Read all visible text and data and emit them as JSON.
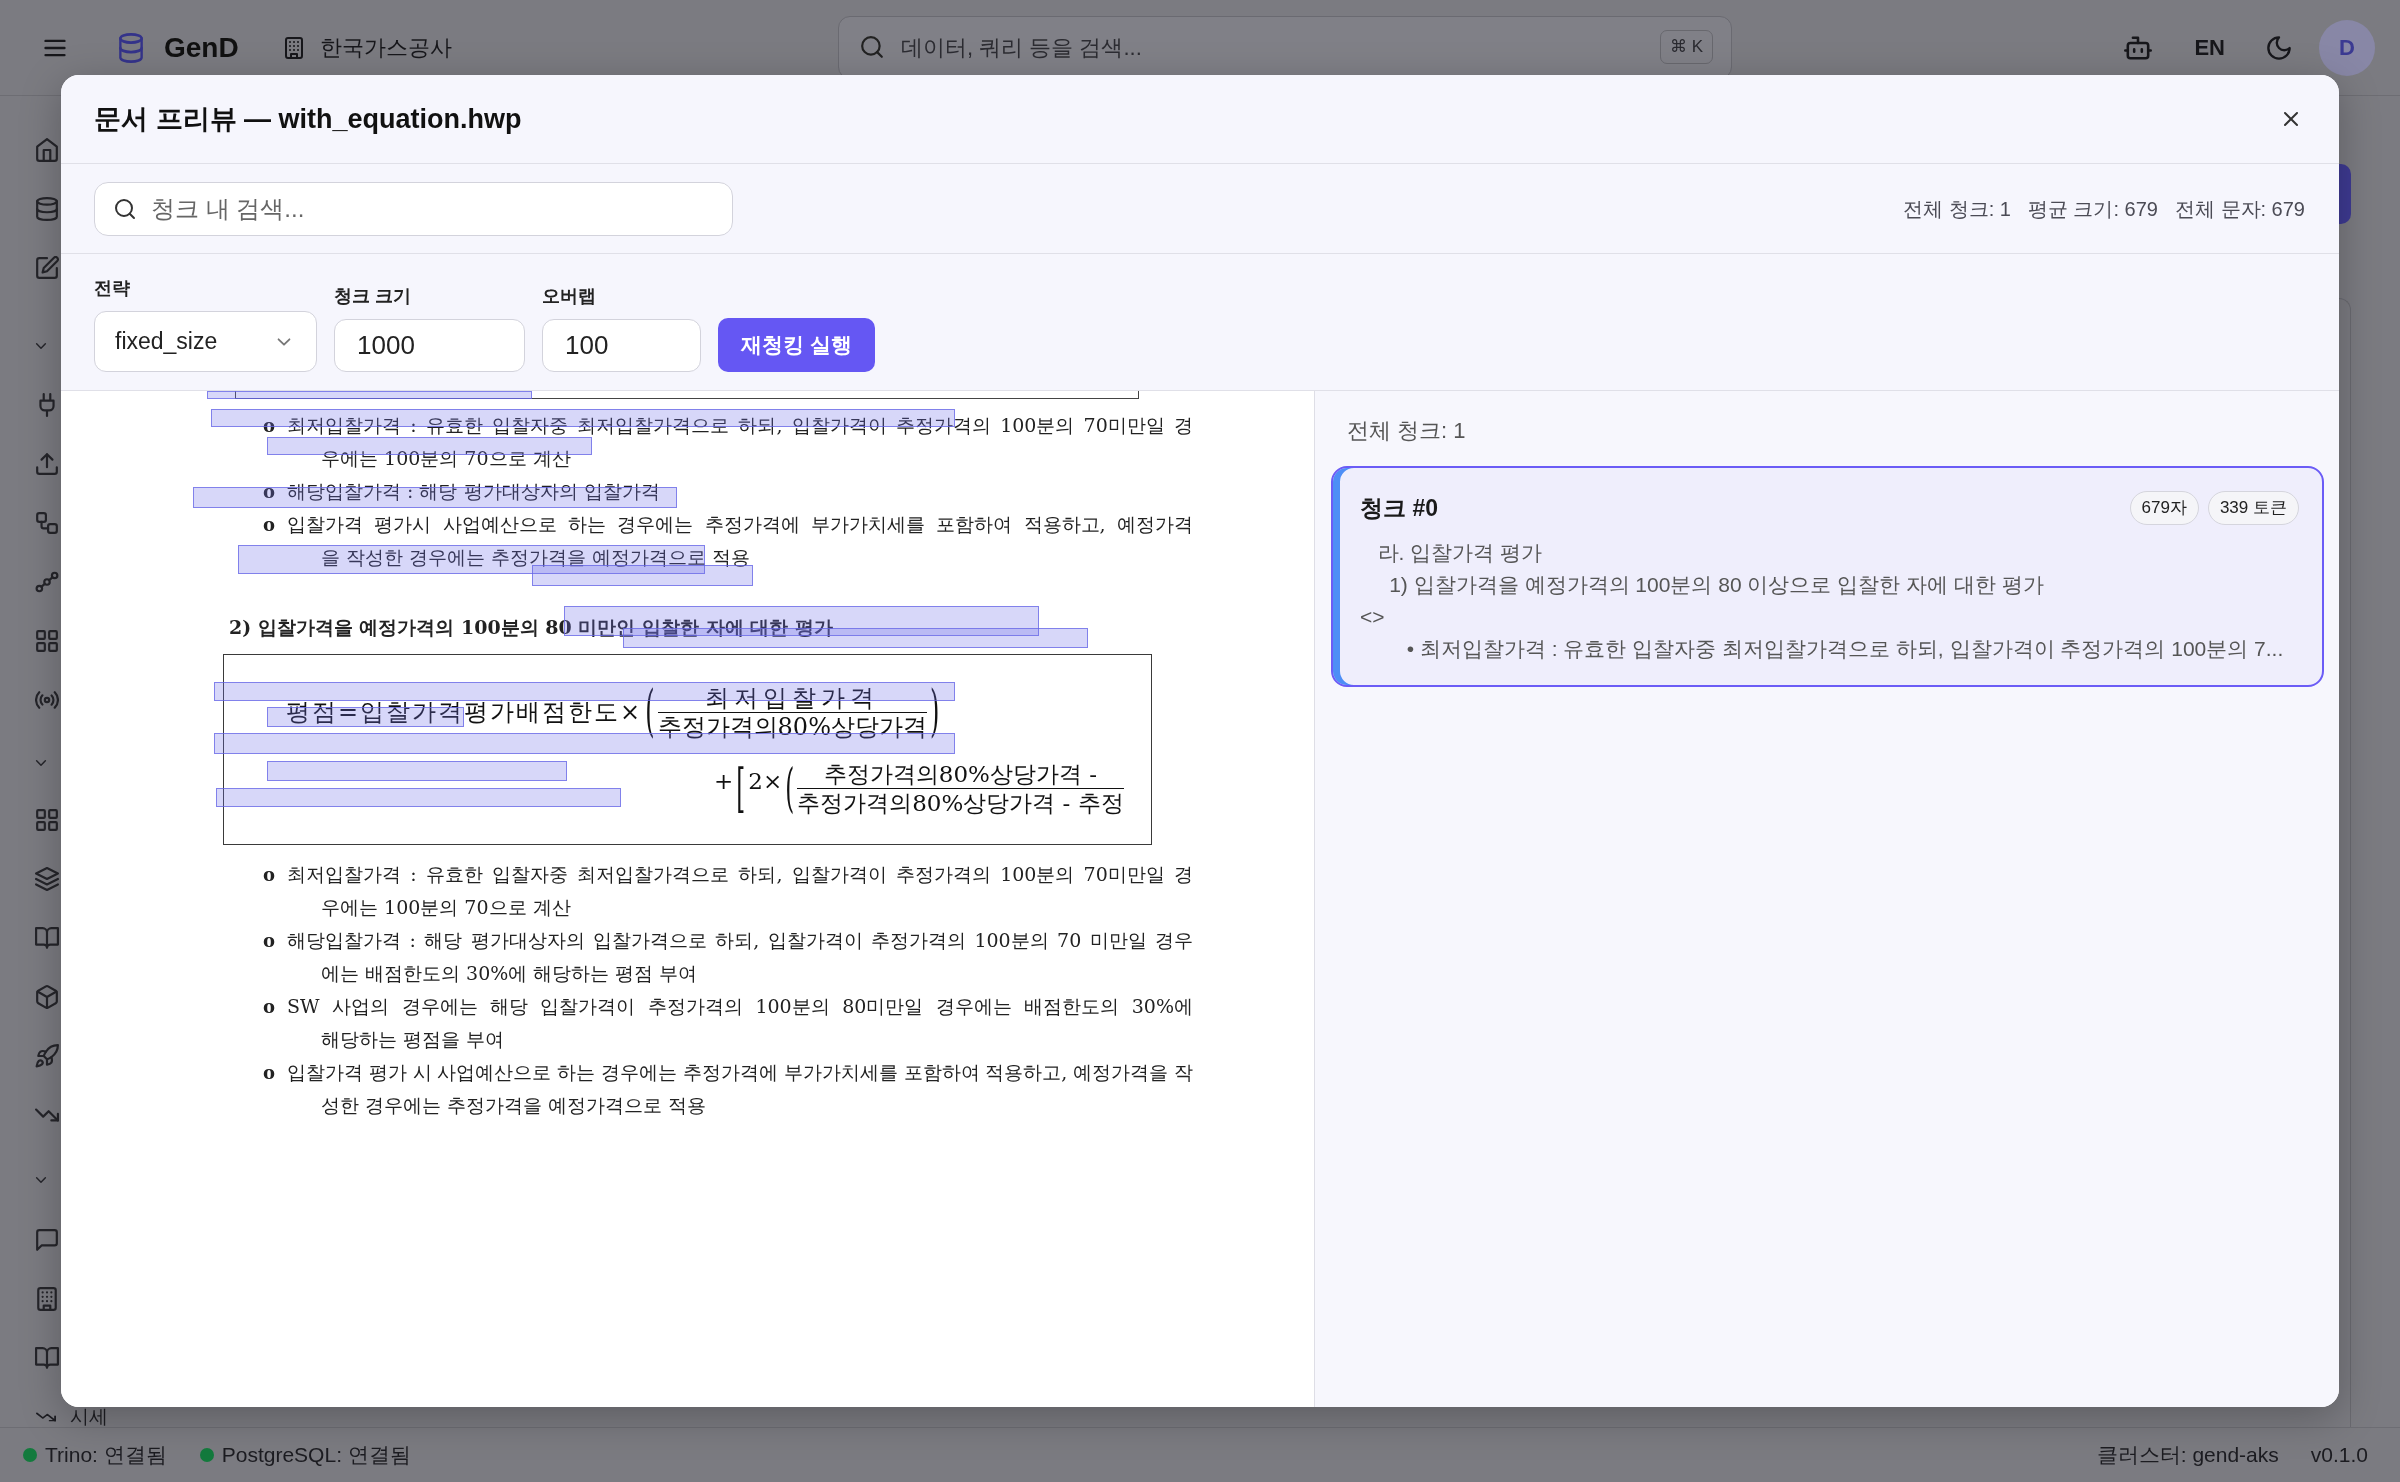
{
  "topbar": {
    "brand": "GenD",
    "organization": "한국가스공사",
    "search": {
      "placeholder": "데이터, 쿼리 등을 검색...",
      "shortcut": "⌘ K"
    },
    "language": "EN",
    "avatar": "D"
  },
  "sidebar": {
    "bottom_item": {
      "label": "시세"
    }
  },
  "modal": {
    "title": "문서 프리뷰 — with_equation.hwp",
    "search": {
      "placeholder": "청크 내 검색..."
    },
    "stats": [
      "전체 청크: 1",
      "평균 크기: 679",
      "전체 문자: 679"
    ],
    "controls": {
      "strategy": {
        "label": "전략",
        "value": "fixed_size"
      },
      "chunk_size": {
        "label": "청크 크기",
        "value": "1000"
      },
      "overlap": {
        "label": "오버랩",
        "value": "100"
      },
      "run_button": "재청킹 실행"
    },
    "document": {
      "highlights_visible": true,
      "blocks": [
        {
          "kind": "table_end"
        },
        {
          "kind": "bullet",
          "marker": "o",
          "lines": [
            "최저입찰가격 : 유효한 입찰자중 최저입찰가격으로 하되, 입찰가격이 추정가격의 100분의 70미만일 경",
            "우에는 100분의 70으로 계산"
          ]
        },
        {
          "kind": "bullet",
          "marker": "o",
          "lines": [
            "해당입찰가격 : 해당 평가대상자의 입찰가격"
          ]
        },
        {
          "kind": "bullet",
          "marker": "o",
          "lines": [
            "입찰가격 평가시 사업예산으로 하는 경우에는 추정가격에 부가가치세를 포함하여 적용하고, 예정가격",
            "을 작성한 경우에는 추정가격을 예정가격으로 적용"
          ]
        },
        {
          "kind": "heading",
          "text": "2) 입찰가격을 예정가격의 100분의 80 미만인 입찰한 자에 대한 평가"
        },
        {
          "kind": "equation",
          "rows": [
            {
              "parts": [
                {
                  "kind": "text",
                  "text": "평점=입찰가격평가배점한도×"
                },
                {
                  "kind": "fence",
                  "text": "("
                },
                {
                  "kind": "fraction",
                  "numerator": "최저입찰가격",
                  "denominator": "추정가격의80%상당가격"
                },
                {
                  "kind": "fence",
                  "text": ")"
                }
              ]
            },
            {
              "parts": [
                {
                  "kind": "text",
                  "text": "+"
                },
                {
                  "kind": "fence",
                  "text": "["
                },
                {
                  "kind": "text",
                  "text": "2×"
                },
                {
                  "kind": "fence",
                  "text": "("
                },
                {
                  "kind": "fraction",
                  "numerator": "추정가격의80%상당가격 -",
                  "denominator": "추정가격의80%상당가격 - 추정"
                }
              ]
            }
          ]
        },
        {
          "kind": "bullet",
          "marker": "o",
          "lines": [
            "최저입찰가격 : 유효한 입찰자중 최저입찰가격으로 하되, 입찰가격이 추정가격의 100분의 70미만일 경",
            "우에는 100분의 70으로 계산"
          ]
        },
        {
          "kind": "bullet",
          "marker": "o",
          "lines": [
            "해당입찰가격 : 해당 평가대상자의 입찰가격으로 하되, 입찰가격이 추정가격의 100분의 70 미만일 경우",
            "에는 배점한도의 30%에 해당하는 평점 부여"
          ]
        },
        {
          "kind": "bullet",
          "marker": "o",
          "lines": [
            "SW 사업의 경우에는 해당 입찰가격이 추정가격의 100분의 80미만일 경우에는 배점한도의 30%에",
            "해당하는 평점을 부여"
          ]
        },
        {
          "kind": "bullet",
          "marker": "o",
          "lines": [
            "입찰가격 평가 시 사업예산으로 하는 경우에는 추정가격에 부가가치세를 포함하여 적용하고, 예정가격을 작",
            "성한 경우에는 추정가격을 예정가격으로 적용"
          ]
        }
      ]
    },
    "chunks": {
      "total": "전체 청크: 1",
      "items": [
        {
          "title": "청크 #0",
          "badges": [
            "679자",
            "339 토큰"
          ],
          "preview": "   라. 입찰가격 평가\n     1) 입찰가격을 예정가격의 100분의 80 이상으로 입찰한 자에 대한 평가\n<>\n        • 최저입찰가격 : 유효한 입찰자중 최저입찰가격으로 하되, 입찰가격이 추정가격의 100분의 7...",
          "selected": true
        }
      ]
    }
  },
  "status_bar": {
    "connections": [
      {
        "label": "Trino: 연결됨",
        "connected": true
      },
      {
        "label": "PostgreSQL: 연결됨",
        "connected": true
      }
    ],
    "cluster": "클러스터: gend-aks",
    "version": "v0.1.0"
  }
}
